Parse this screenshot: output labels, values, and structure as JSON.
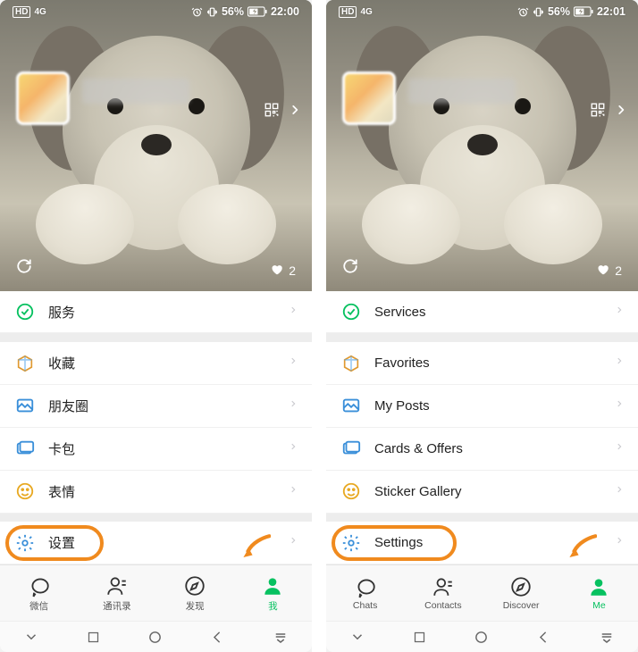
{
  "left": {
    "status": {
      "battery": "56%",
      "time": "22:00"
    },
    "likes": "2",
    "menu": {
      "services": "服务",
      "favorites": "收藏",
      "posts": "朋友圈",
      "cards": "卡包",
      "stickers": "表情",
      "settings": "设置"
    },
    "tabs": {
      "chats": "微信",
      "contacts": "通讯录",
      "discover": "发现",
      "me": "我"
    }
  },
  "right": {
    "status": {
      "battery": "56%",
      "time": "22:01"
    },
    "likes": "2",
    "menu": {
      "services": "Services",
      "favorites": "Favorites",
      "posts": "My Posts",
      "cards": "Cards & Offers",
      "stickers": "Sticker Gallery",
      "settings": "Settings"
    },
    "tabs": {
      "chats": "Chats",
      "contacts": "Contacts",
      "discover": "Discover",
      "me": "Me"
    }
  },
  "colors": {
    "accent": "#07c160",
    "highlight": "#f08a1e"
  }
}
